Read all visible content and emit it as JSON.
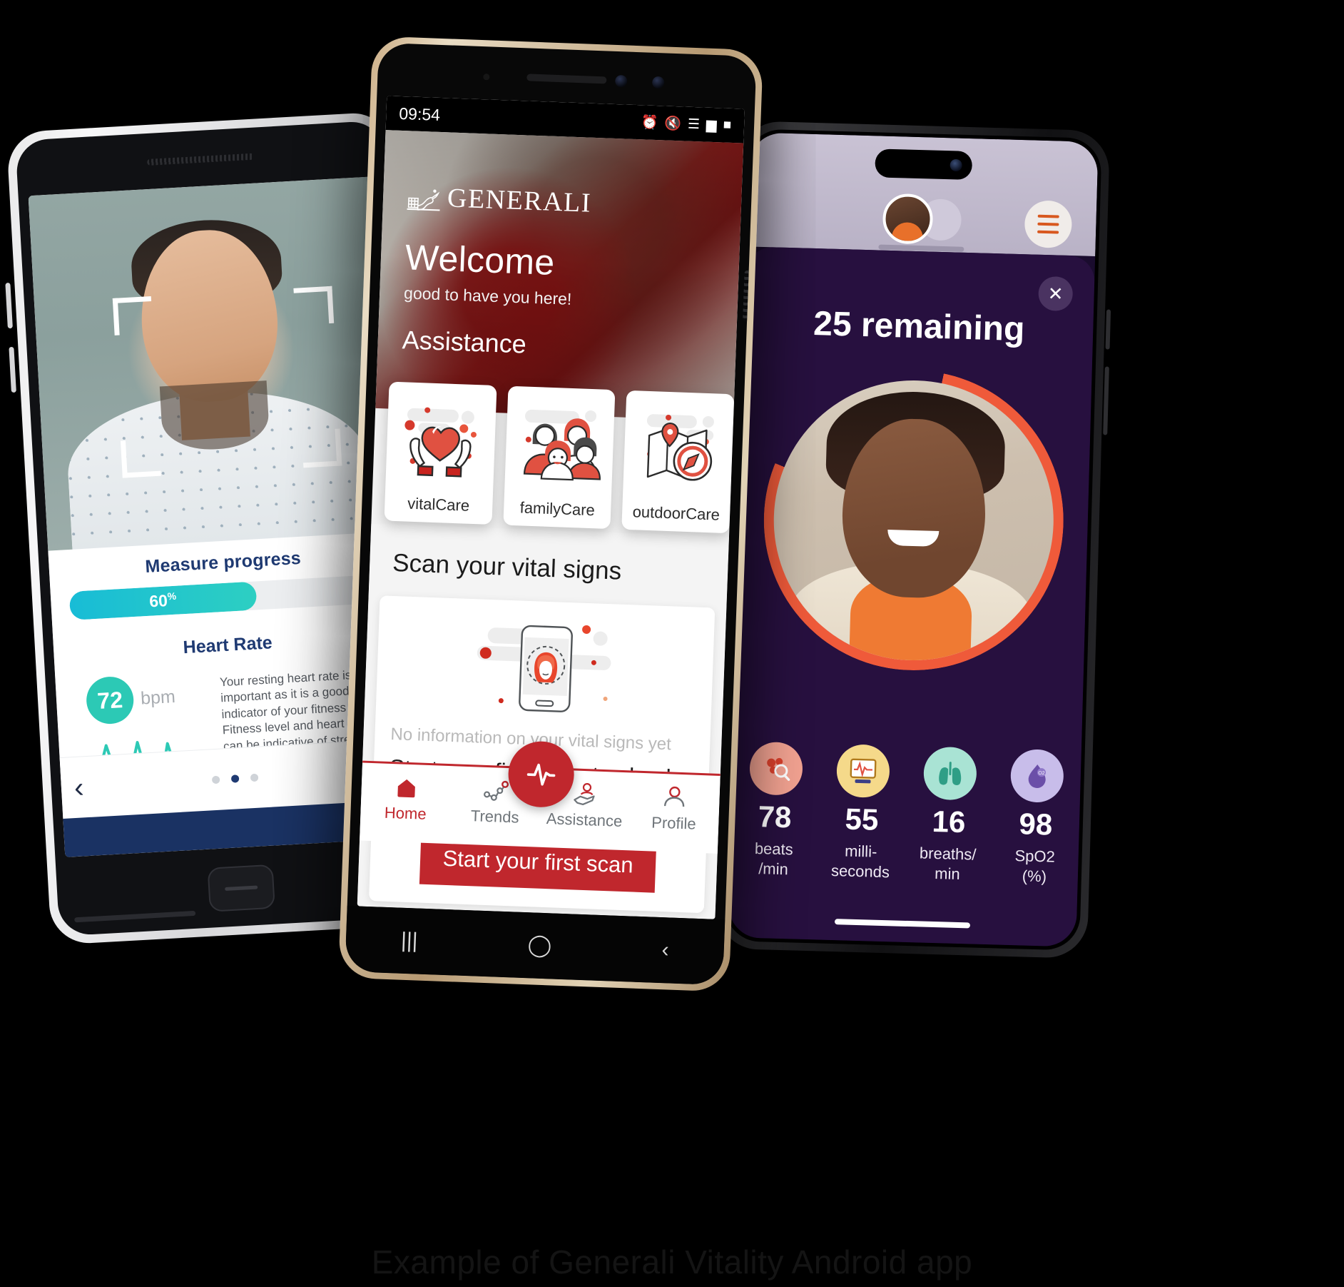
{
  "caption": "Example of Generali Vitality Android app",
  "left_phone": {
    "name": "vital-signs-results-phone",
    "progress_title": "Measure progress",
    "progress_value": "60",
    "progress_percent_symbol": "%",
    "progress_fraction": 60,
    "heart_rate_title": "Heart Rate",
    "bpm_value": "72",
    "bpm_unit": "bpm",
    "heart_rate_description": "Your resting heart rate is important as it is a good indicator of your fitness level. Fitness level and heart rate can be indicative of stress levels",
    "prev_arrow": "‹",
    "pager_dots": 3,
    "pager_active_index": 1
  },
  "center_phone": {
    "name": "generali-home-phone",
    "status_bar": {
      "time": "09:54",
      "icons": [
        "alarm-icon",
        "mute-icon",
        "wifi-icon",
        "signal-icon",
        "battery-icon"
      ]
    },
    "brand": "GENERALI",
    "welcome_title": "Welcome",
    "welcome_subtitle": "good to have you here!",
    "assistance_heading": "Assistance",
    "assistance_cards": [
      {
        "label": "vitalCare",
        "icon": "hands-holding-heart-icon"
      },
      {
        "label": "familyCare",
        "icon": "family-group-icon"
      },
      {
        "label": "outdoorCare",
        "icon": "map-compass-icon"
      }
    ],
    "scan_heading": "Scan your vital signs",
    "scan_card": {
      "illustration": "phone-face-scan-icon",
      "no_info_text": "No information on your vital signs yet",
      "cta_copy": "Start your first scan to check your vital signs now!",
      "button_label": "Start your first scan"
    },
    "tabs": [
      {
        "label": "Home",
        "icon": "home-icon",
        "active": true
      },
      {
        "label": "Trends",
        "icon": "trends-chart-icon",
        "active": false
      },
      {
        "label": "Assistance",
        "icon": "assistance-hand-icon",
        "active": false
      },
      {
        "label": "Profile",
        "icon": "profile-person-icon",
        "active": false
      }
    ],
    "fab": {
      "icon": "heartbeat-pulse-icon"
    },
    "system_nav": [
      "recents-icon",
      "home-circle-icon",
      "back-icon"
    ],
    "accent_color": "#C0272D"
  },
  "right_phone": {
    "name": "scan-in-progress-phone",
    "menu_icon": "hamburger-menu-icon",
    "avatar": "user-avatar",
    "close_icon": "close-icon",
    "remaining_label": "25 remaining",
    "progress_ring_percent": 78,
    "ring_color": "#EF5A3A",
    "vitals": [
      {
        "value": "78",
        "unit_line1": "beats",
        "unit_line2": "/min",
        "icon": "blood-drop-icon",
        "icon_bg": "#F2A291"
      },
      {
        "value": "55",
        "unit_line1": "milli-",
        "unit_line2": "seconds",
        "icon": "ecg-monitor-icon",
        "icon_bg": "#F5D98A"
      },
      {
        "value": "16",
        "unit_line1": "breaths/",
        "unit_line2": "min",
        "icon": "lungs-icon",
        "icon_bg": "#A9E3D4"
      },
      {
        "value": "98",
        "unit_line1": "SpO2",
        "unit_line2": "(%)",
        "icon": "oxygen-drop-icon",
        "icon_bg": "#C8BDEA"
      }
    ],
    "background_color": "#27103F"
  }
}
